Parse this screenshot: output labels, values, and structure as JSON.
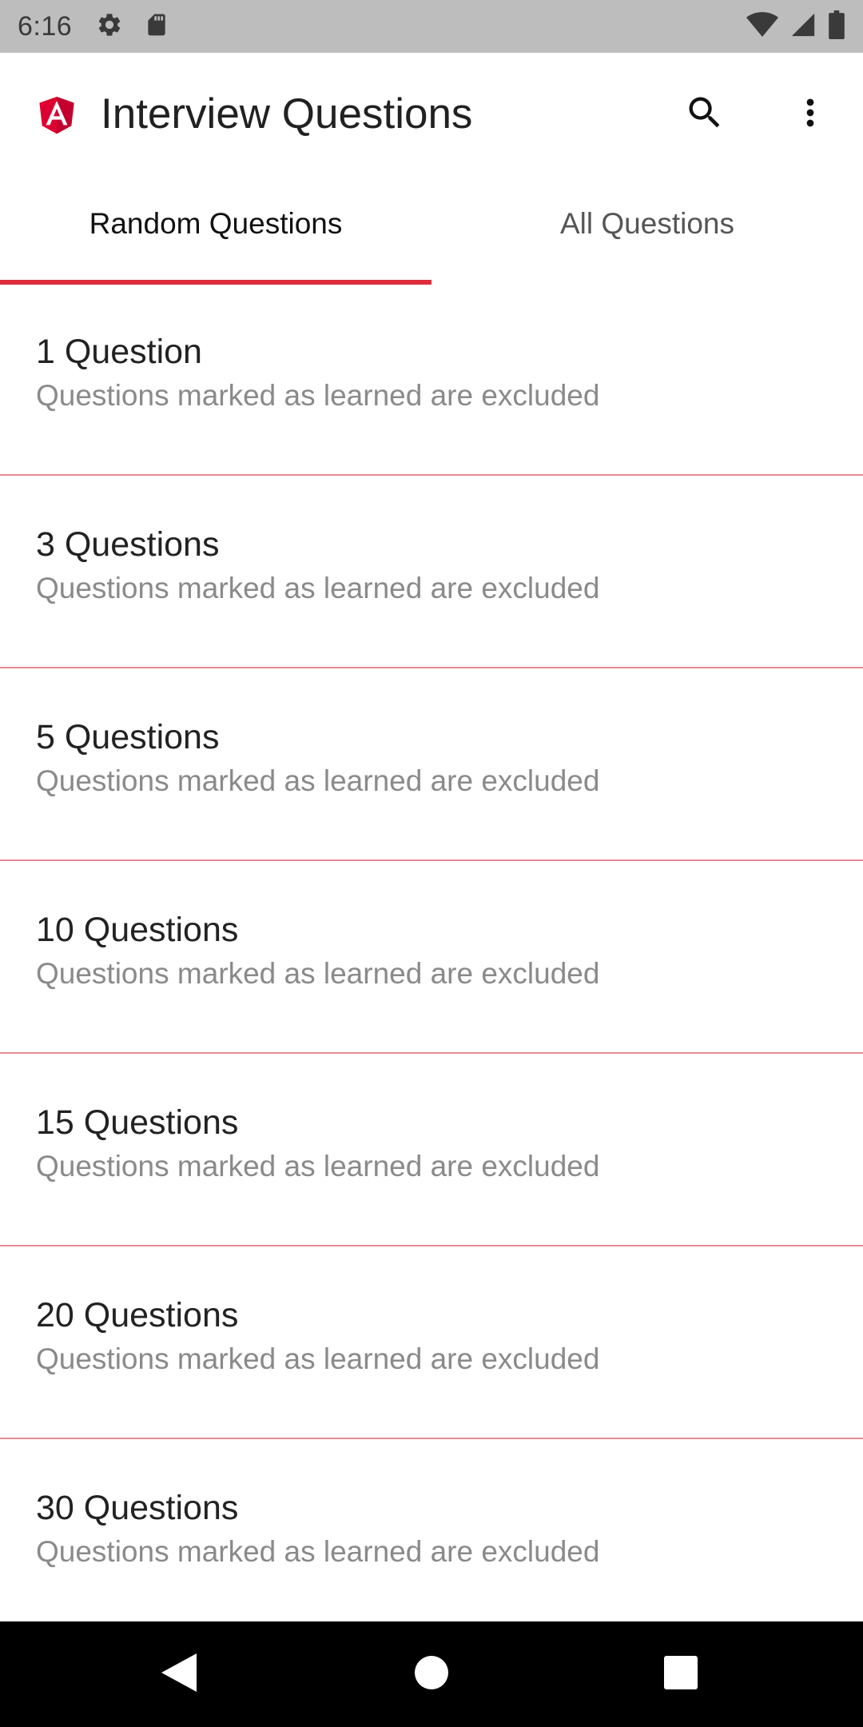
{
  "status_bar": {
    "time": "6:16",
    "left_icons": [
      "settings-icon",
      "sd-card-icon"
    ],
    "right_icons": [
      "wifi-icon",
      "cellular-signal-icon",
      "battery-icon"
    ]
  },
  "app_bar": {
    "title": "Interview Questions",
    "logo": "angular-logo",
    "actions": [
      "search-icon",
      "more-vert-icon"
    ],
    "accent_color": "#dd2c3c"
  },
  "tabs": [
    {
      "label": "Random Questions",
      "active": true
    },
    {
      "label": "All Questions",
      "active": false
    }
  ],
  "question_list": [
    {
      "title": "1 Question",
      "subtitle": "Questions marked as learned are excluded"
    },
    {
      "title": "3 Questions",
      "subtitle": "Questions marked as learned are excluded"
    },
    {
      "title": "5 Questions",
      "subtitle": "Questions marked as learned are excluded"
    },
    {
      "title": "10 Questions",
      "subtitle": "Questions marked as learned are excluded"
    },
    {
      "title": "15 Questions",
      "subtitle": "Questions marked as learned are excluded"
    },
    {
      "title": "20 Questions",
      "subtitle": "Questions marked as learned are excluded"
    },
    {
      "title": "30 Questions",
      "subtitle": "Questions marked as learned are excluded"
    }
  ],
  "nav_bar": {
    "buttons": [
      "back-icon",
      "home-icon",
      "recents-icon"
    ]
  }
}
